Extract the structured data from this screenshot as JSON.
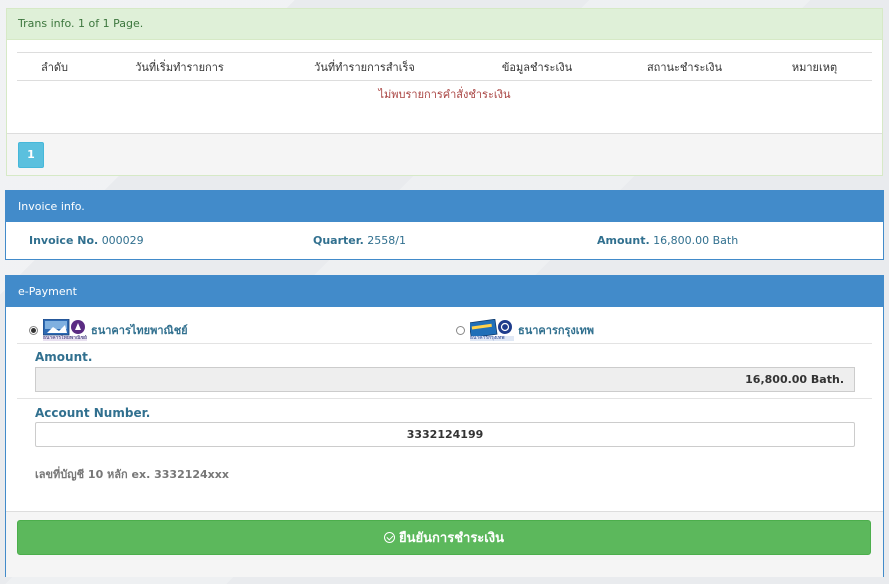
{
  "trans": {
    "header": "Trans info. 1 of 1 Page.",
    "columns": [
      "ลำดับ",
      "วันที่เริ่มทำรายการ",
      "วันที่ทำรายการสำเร็จ",
      "ข้อมูลชำระเงิน",
      "สถานะชำระเงิน",
      "หมายเหตุ"
    ],
    "empty_message": "ไม่พบรายการคำสั่งชำระเงิน",
    "page": "1"
  },
  "invoice": {
    "header": "Invoice info.",
    "invoice_no_label": "Invoice No.",
    "invoice_no": "000029",
    "quarter_label": "Quarter.",
    "quarter": "2558/1",
    "amount_label": "Amount.",
    "amount": "16,800.00 Bath"
  },
  "payment": {
    "header": "e-Payment",
    "banks": [
      {
        "name": "ธนาคารไทยพาณิชย์",
        "selected": true,
        "logo_caption": "ธนาคารไทยพาณิชย์",
        "icon": "scb-bank-logo"
      },
      {
        "name": "ธนาคารกรุงเทพ",
        "selected": false,
        "logo_caption": "ธนาคารกรุงเทพ",
        "icon": "bbl-bank-logo"
      }
    ],
    "amount_label": "Amount.",
    "amount_value": "16,800.00 Bath.",
    "account_label": "Account Number.",
    "account_value": "3332124199",
    "hint": "เลขที่บัญชี 10 หลัก ex. 3332124xxx",
    "submit_label": "ยืนยันการชำระเงิน"
  },
  "colors": {
    "success_bg": "#dff0d8",
    "primary": "#428bca",
    "info_text": "#31708f",
    "submit": "#5cb85c",
    "page_button": "#5bc0de",
    "empty_text": "#a94442"
  }
}
